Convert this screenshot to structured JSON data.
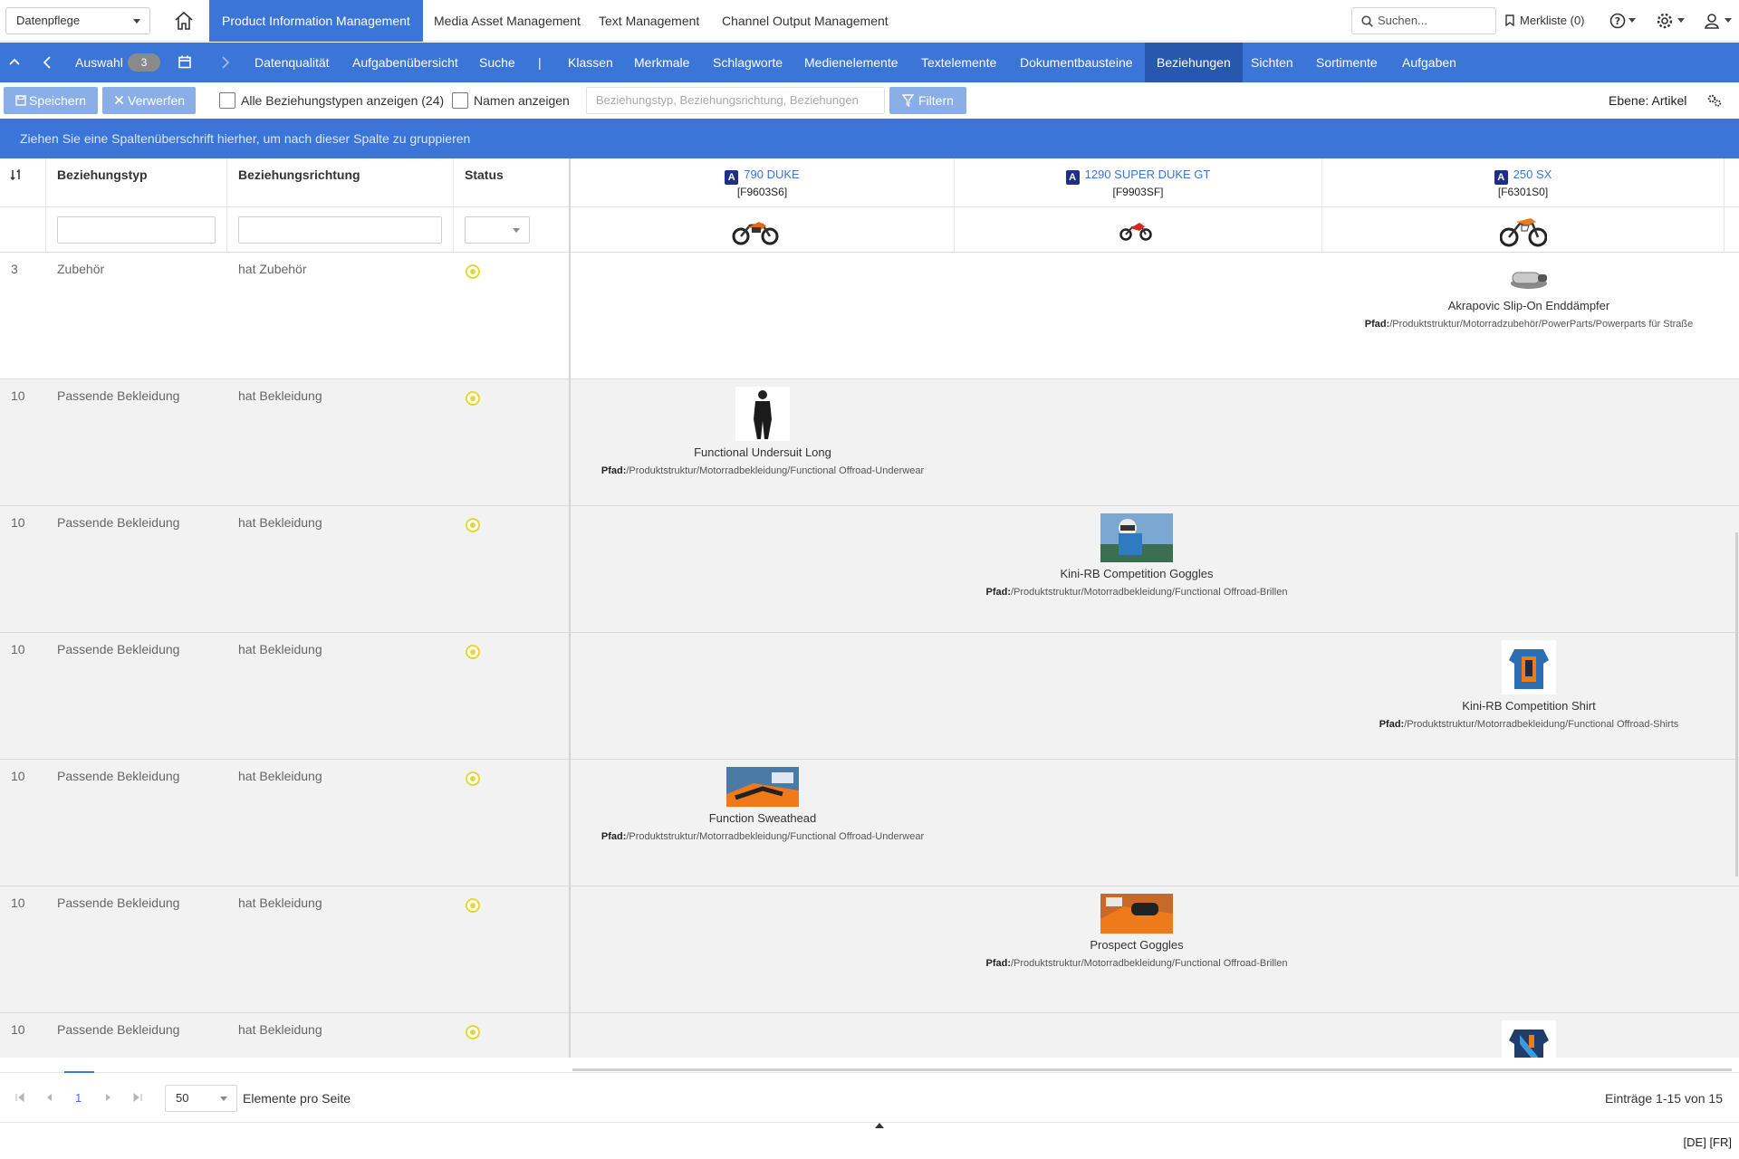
{
  "workspace": {
    "selected": "Datenpflege"
  },
  "app_tabs": [
    {
      "label": "Product Information Management",
      "active": true
    },
    {
      "label": "Media Asset Management",
      "active": false
    },
    {
      "label": "Text Management",
      "active": false
    },
    {
      "label": "Channel Output Management",
      "active": false
    }
  ],
  "search": {
    "placeholder": "Suchen..."
  },
  "merkliste": {
    "label": "Merkliste (0)"
  },
  "nav": {
    "auswahl_label": "Auswahl",
    "auswahl_count": "3",
    "items": [
      {
        "label": "Datenqualität",
        "active": false
      },
      {
        "label": "Aufgabenübersicht",
        "active": false
      },
      {
        "label": "Suche",
        "active": false
      },
      {
        "label": "|",
        "active": false
      },
      {
        "label": "Klassen",
        "active": false
      },
      {
        "label": "Merkmale",
        "active": false
      },
      {
        "label": "Schlagworte",
        "active": false
      },
      {
        "label": "Medienelemente",
        "active": false
      },
      {
        "label": "Textelemente",
        "active": false
      },
      {
        "label": "Dokumentbausteine",
        "active": false
      },
      {
        "label": "Beziehungen",
        "active": true
      },
      {
        "label": "Sichten",
        "active": false
      },
      {
        "label": "Sortimente",
        "active": false
      },
      {
        "label": "Aufgaben",
        "active": false
      }
    ]
  },
  "toolbar": {
    "save_label": "Speichern",
    "discard_label": "Verwerfen",
    "show_all_label": "Alle Beziehungstypen anzeigen (24)",
    "show_names_label": "Namen anzeigen",
    "filter_placeholder": "Beziehungstyp, Beziehungsrichtung, Beziehungen",
    "filter_label": "Filtern",
    "ebene_label": "Ebene: Artikel"
  },
  "group_hint": "Ziehen Sie eine Spaltenüberschrift hierher, um nach dieser Spalte zu gruppieren",
  "columns": {
    "type": "Beziehungstyp",
    "direction": "Beziehungsrichtung",
    "status": "Status"
  },
  "products": [
    {
      "badge": "A",
      "name": "790 DUKE",
      "code": "[F9603S6]"
    },
    {
      "badge": "A",
      "name": "1290 SUPER DUKE GT",
      "code": "[F9903SF]"
    },
    {
      "badge": "A",
      "name": "250 SX",
      "code": "[F6301S0]"
    }
  ],
  "status_color": "#e6d830",
  "accent_color": "#3a75d7",
  "rows": [
    {
      "num": "3",
      "type": "Zubehör",
      "direction": "hat Zubehör",
      "status": "in-progress",
      "rel": {
        "col": 2,
        "name": "Akrapovic Slip-On Enddämpfer",
        "path_label": "Pfad:",
        "path": "/Produktstruktur/Motorradzubehör/PowerParts/Powerparts für Straße"
      }
    },
    {
      "num": "10",
      "type": "Passende Bekleidung",
      "direction": "hat Bekleidung",
      "status": "in-progress",
      "rel": {
        "col": 0,
        "name": "Functional Undersuit Long",
        "path_label": "Pfad:",
        "path": "/Produktstruktur/Motorradbekleidung/Functional Offroad-Underwear"
      }
    },
    {
      "num": "10",
      "type": "Passende Bekleidung",
      "direction": "hat Bekleidung",
      "status": "in-progress",
      "rel": {
        "col": 1,
        "name": "Kini-RB Competition Goggles",
        "path_label": "Pfad:",
        "path": "/Produktstruktur/Motorradbekleidung/Functional Offroad-Brillen"
      }
    },
    {
      "num": "10",
      "type": "Passende Bekleidung",
      "direction": "hat Bekleidung",
      "status": "in-progress",
      "rel": {
        "col": 2,
        "name": "Kini-RB Competition Shirt",
        "path_label": "Pfad:",
        "path": "/Produktstruktur/Motorradbekleidung/Functional Offroad-Shirts"
      }
    },
    {
      "num": "10",
      "type": "Passende Bekleidung",
      "direction": "hat Bekleidung",
      "status": "in-progress",
      "rel": {
        "col": 0,
        "name": "Function Sweathead",
        "path_label": "Pfad:",
        "path": "/Produktstruktur/Motorradbekleidung/Functional Offroad-Underwear"
      }
    },
    {
      "num": "10",
      "type": "Passende Bekleidung",
      "direction": "hat Bekleidung",
      "status": "in-progress",
      "rel": {
        "col": 1,
        "name": "Prospect Goggles",
        "path_label": "Pfad:",
        "path": "/Produktstruktur/Motorradbekleidung/Functional Offroad-Brillen"
      }
    },
    {
      "num": "10",
      "type": "Passende Bekleidung",
      "direction": "hat Bekleidung",
      "status": "in-progress",
      "rel": {
        "col": 2,
        "name": "",
        "path_label": "",
        "path": ""
      }
    }
  ],
  "pager": {
    "page": "1",
    "page_size": "50",
    "page_size_label": "Elemente pro Seite",
    "info": "Einträge 1-15 von 15"
  },
  "languages": "[DE] [FR]"
}
